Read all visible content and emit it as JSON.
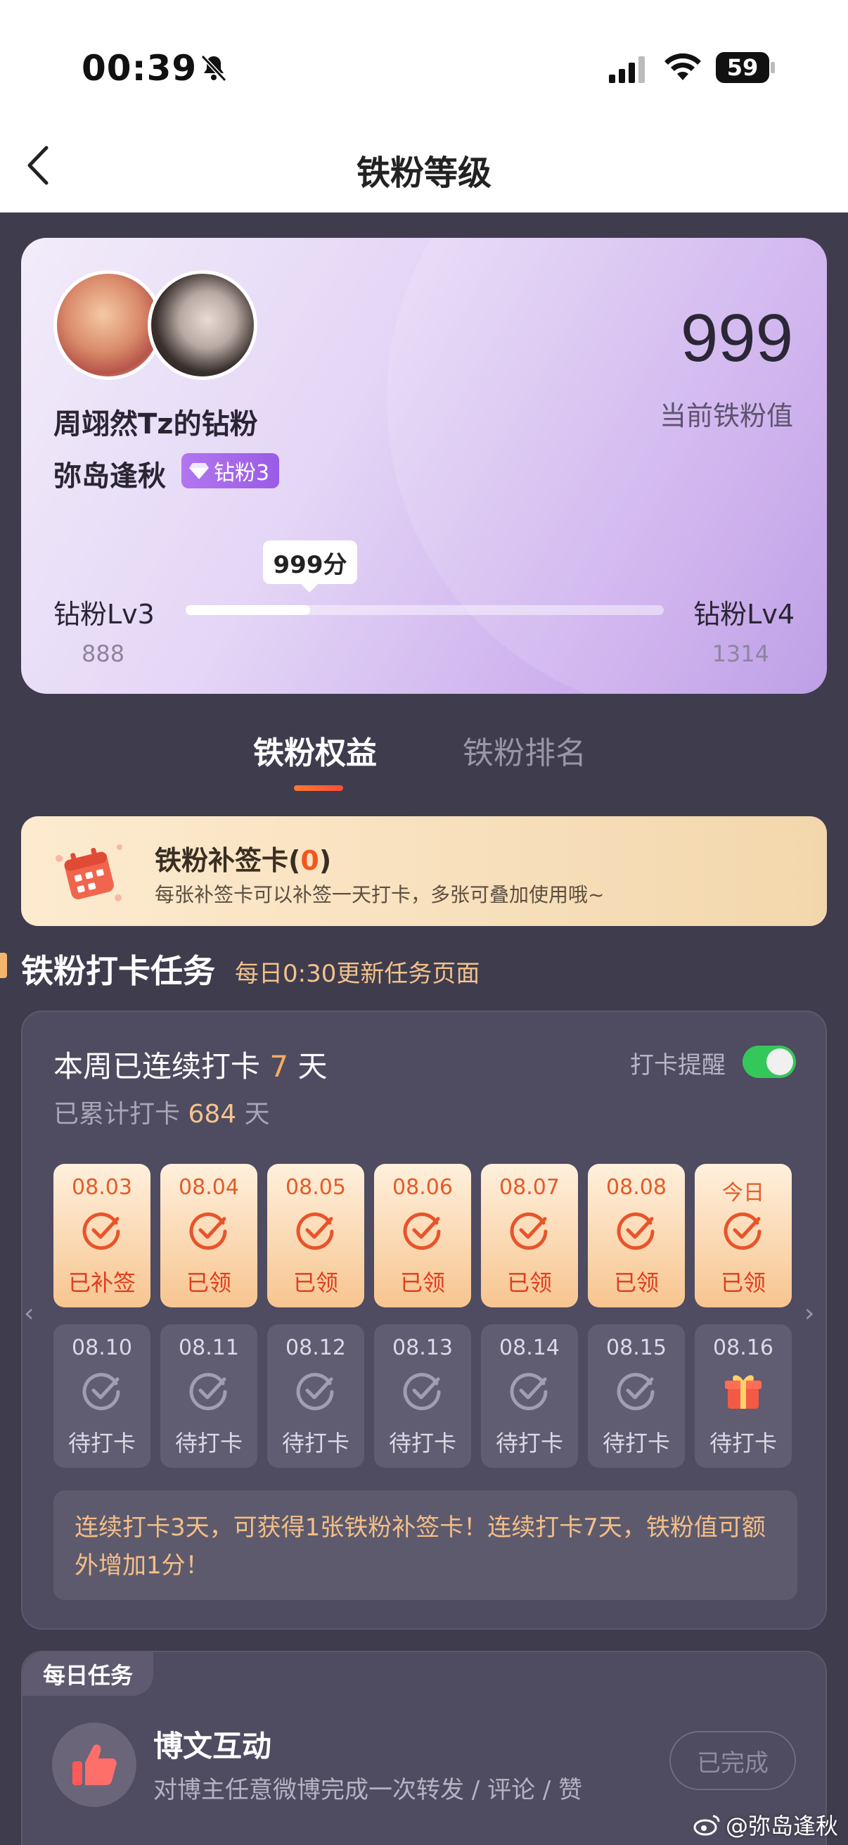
{
  "status_bar": {
    "time": "00:39",
    "battery": "59"
  },
  "header": {
    "title": "铁粉等级"
  },
  "hero": {
    "fan_title": "周翊然Tz的钻粉",
    "user_name": "弥岛逢秋",
    "badge": "钻粉3",
    "score": "999",
    "score_label": "当前铁粉值",
    "bubble": "999分",
    "level_left": "钻粉Lv3",
    "level_right": "钻粉Lv4",
    "level_left_value": "888",
    "level_right_value": "1314",
    "progress_fraction": 0.26
  },
  "tabs": [
    {
      "label": "铁粉权益",
      "active": true
    },
    {
      "label": "铁粉排名",
      "active": false
    }
  ],
  "makeup_card": {
    "title_prefix": "铁粉补签卡(",
    "count": "0",
    "title_suffix": ")",
    "subtitle": "每张补签卡可以补签一天打卡，多张可叠加使用哦~"
  },
  "section": {
    "title": "铁粉打卡任务",
    "subtitle": "每日0:30更新任务页面"
  },
  "checkin": {
    "streak_prefix": "本周已连续打卡",
    "streak_days": "7",
    "streak_suffix": "天",
    "total_prefix": "已累计打卡",
    "total_days": "684",
    "total_suffix": "天",
    "remind_label": "打卡提醒",
    "remind_on": true,
    "week1": [
      {
        "date": "08.03",
        "status": "已补签"
      },
      {
        "date": "08.04",
        "status": "已领"
      },
      {
        "date": "08.05",
        "status": "已领"
      },
      {
        "date": "08.06",
        "status": "已领"
      },
      {
        "date": "08.07",
        "status": "已领"
      },
      {
        "date": "08.08",
        "status": "已领"
      },
      {
        "date": "今日",
        "status": "已领"
      }
    ],
    "week2": [
      {
        "date": "08.10",
        "status": "待打卡"
      },
      {
        "date": "08.11",
        "status": "待打卡"
      },
      {
        "date": "08.12",
        "status": "待打卡"
      },
      {
        "date": "08.13",
        "status": "待打卡"
      },
      {
        "date": "08.14",
        "status": "待打卡"
      },
      {
        "date": "08.15",
        "status": "待打卡"
      },
      {
        "date": "08.16",
        "status": "待打卡"
      }
    ],
    "tip": "连续打卡3天，可获得1张铁粉补签卡！连续打卡7天，铁粉值可额外增加1分！"
  },
  "daily_task": {
    "tag": "每日任务",
    "title": "博文互动",
    "description": "对博主任意微博完成一次转发 / 评论 / 赞",
    "button": "已完成"
  },
  "watermark": "@弥岛逢秋",
  "colors": {
    "background": "#3f3c4e",
    "accent_orange": "#f0581e",
    "toggle_on": "#34c759"
  }
}
